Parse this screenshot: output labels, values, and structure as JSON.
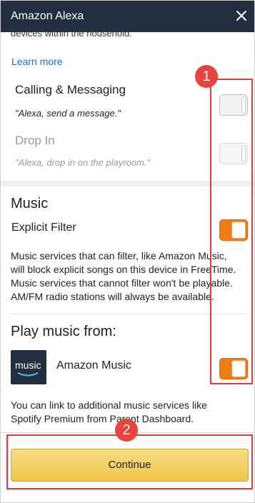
{
  "window": {
    "title": "Amazon Alexa"
  },
  "top_cut_text": "devices within the household.",
  "learn_more": "Learn more",
  "calling": {
    "title": "Calling & Messaging",
    "quote": "\"Alexa, send a message.\"",
    "enabled": false
  },
  "dropin": {
    "title": "Drop In",
    "quote": "\"Alexa, drop in on the playroom.\"",
    "enabled": false,
    "disabled": true
  },
  "music": {
    "section_title": "Music",
    "explicit_filter_label": "Explicit Filter",
    "explicit_filter_on": true,
    "description_lines": [
      "Music services that can filter, like Amazon Music,",
      "will block explicit songs on this device in FreeTime.",
      "Music services that cannot filter won't be playable.",
      "AM/FM radio stations will always be available."
    ]
  },
  "play_from": {
    "title": "Play music from:",
    "service_logo_text": "music",
    "service_name": "Amazon Music",
    "service_on": true,
    "link_lines": [
      "You can link to additional music services like",
      "Spotify Premium from Parent Dashboard."
    ]
  },
  "continue_label": "Continue",
  "annotations": {
    "badge1": "1",
    "badge2": "2"
  },
  "colors": {
    "titlebar": "#232f3e",
    "toggle_on": "#f07c16",
    "link": "#1a73c7",
    "callout": "#e23b3b",
    "button": "#f0c64a"
  },
  "icons": {
    "close": "close-icon",
    "music_logo": "amazon-music-logo-icon"
  }
}
